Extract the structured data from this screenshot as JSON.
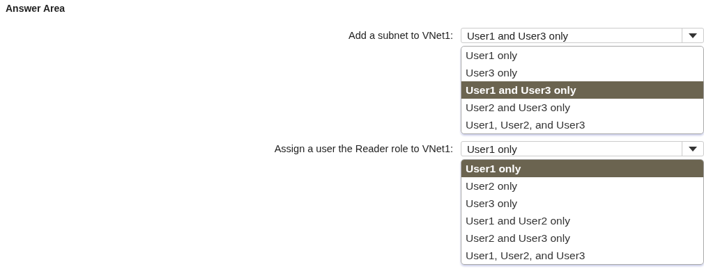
{
  "title": "Answer Area",
  "questions": [
    {
      "label": "Add a subnet to VNet1:",
      "value": "User1 and User3 only",
      "options": [
        {
          "label": "User1 only",
          "selected": false
        },
        {
          "label": "User3 only",
          "selected": false
        },
        {
          "label": "User1 and User3 only",
          "selected": true
        },
        {
          "label": "User2 and User3 only",
          "selected": false
        },
        {
          "label": "User1, User2, and User3",
          "selected": false
        }
      ]
    },
    {
      "label": "Assign a user the Reader role to VNet1:",
      "value": "User1 only",
      "options": [
        {
          "label": "User1 only",
          "selected": true
        },
        {
          "label": "User2 only",
          "selected": false
        },
        {
          "label": "User3 only",
          "selected": false
        },
        {
          "label": "User1 and User2 only",
          "selected": false
        },
        {
          "label": "User2 and User3 only",
          "selected": false
        },
        {
          "label": "User1, User2, and User3",
          "selected": false
        }
      ]
    }
  ]
}
